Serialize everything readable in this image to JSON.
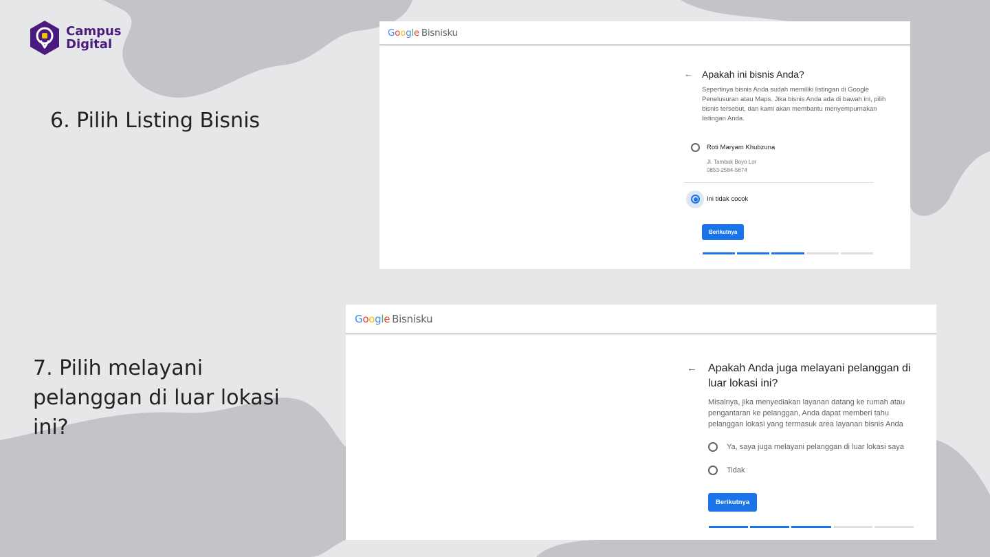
{
  "brand": {
    "line1": "Campus",
    "line2": "Digital"
  },
  "steps": {
    "step6": "6. Pilih Listing Bisnis",
    "step7": "7. Pilih melayani pelanggan di luar lokasi ini?"
  },
  "colors": {
    "accent": "#1a73e8",
    "brand": "#4b1a7f"
  },
  "panel1": {
    "header": {
      "google": "Google",
      "product": "Bisnisku"
    },
    "title": "Apakah ini bisnis Anda?",
    "description": "Sepertinya bisnis Anda sudah memiliki listingan di Google Penelusuran atau Maps. Jika bisnis Anda ada di bawah ini, pilih bisnis tersebut, dan kami akan membantu menyempurnakan listingan Anda.",
    "options": [
      {
        "label": "Roti Maryam Khubzuna",
        "address": "Jl. Tambak Boyo Lor",
        "phone": "0853-2584-5674",
        "selected": false
      },
      {
        "label": "Ini tidak cocok",
        "selected": true
      }
    ],
    "button": "Berikutnya",
    "progress": {
      "completed": 3,
      "total": 5
    }
  },
  "panel2": {
    "header": {
      "google": "Google",
      "product": "Bisnisku"
    },
    "title": "Apakah Anda juga melayani pelanggan di luar lokasi ini?",
    "description": "Misalnya, jika menyediakan layanan datang ke rumah atau pengantaran ke pelanggan, Anda dapat memberi tahu pelanggan lokasi yang termasuk area layanan bisnis Anda",
    "options": [
      {
        "label": "Ya, saya juga melayani pelanggan di luar lokasi saya",
        "selected": false
      },
      {
        "label": "Tidak",
        "selected": false
      }
    ],
    "button": "Berikutnya",
    "progress": {
      "completed": 3,
      "total": 5
    }
  }
}
